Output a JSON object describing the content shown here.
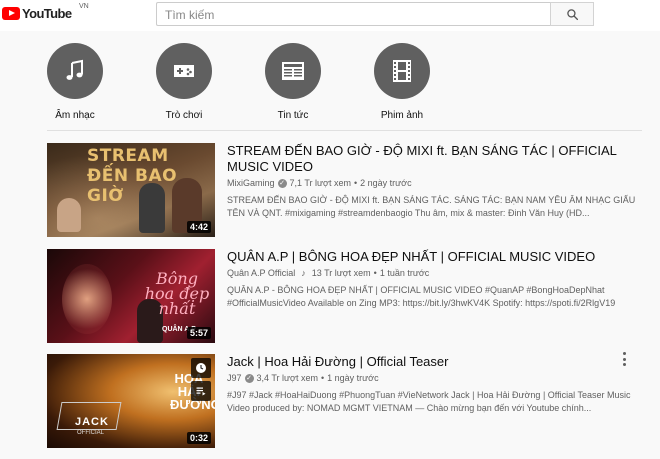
{
  "header": {
    "logo_text": "YouTube",
    "country": "VN",
    "search_placeholder": "Tìm kiếm"
  },
  "categories": [
    {
      "label": "Âm nhạc",
      "icon": "music-note-icon"
    },
    {
      "label": "Trò chơi",
      "icon": "gamepad-icon"
    },
    {
      "label": "Tin tức",
      "icon": "newspaper-icon"
    },
    {
      "label": "Phim ảnh",
      "icon": "film-icon"
    }
  ],
  "videos": [
    {
      "title": "STREAM ĐẾN BAO GIỜ - ĐỘ MIXI ft. BẠN SÁNG TÁC | OFFICIAL MUSIC VIDEO",
      "channel": "MixiGaming",
      "views": "7,1 Tr lượt xem",
      "age": "2 ngày trước",
      "description": "STREAM ĐẾN BAO GIỜ - ĐỘ MIXI ft. BẠN SÁNG TÁC. SÁNG TÁC: BẠN NAM YÊU ÂM NHẠC GIẤU TÊN VÀ QNT. #mixigaming #streamdenbaogio Thu âm, mix & master: Đinh Văn Huy (HD...",
      "duration": "4:42",
      "thumb_text": "STREAM ĐẾN BAO GIỜ"
    },
    {
      "title": "QUÂN A.P | BÔNG HOA ĐẸP NHẤT | OFFICIAL MUSIC VIDEO",
      "channel": "Quân A.P Official",
      "views": "13 Tr lượt xem",
      "age": "1 tuần trước",
      "description": "QUÂN A.P - BÔNG HOA ĐẸP NHẤT | OFFICIAL MUSIC VIDEO #QuanAP #BongHoaDepNhat #OfficialMusicVideo Available on Zing MP3: https://bit.ly/3hwKV4K Spotify: https://spoti.fi/2RlgV19",
      "duration": "5:57",
      "thumb_text": "Bông hoa đẹp nhất",
      "thumb_sub": "QUÂN A.P"
    },
    {
      "title": "Jack | Hoa Hải Đường | Official Teaser",
      "channel": "J97",
      "views": "3,4 Tr lượt xem",
      "age": "1 ngày trước",
      "description": "#J97 #Jack #HoaHaiDuong #PhuongTuan #VieNetwork Jack | Hoa Hải Đường | Official Teaser Music Video produced by: NOMAD MGMT VIETNAM — Chào mừng bạn đến với Youtube chính...",
      "duration": "0:32",
      "thumb_text": "HOA HẢI ĐƯỜNG",
      "thumb_sub": "JACK",
      "thumb_sub2": "OFFICIAL"
    }
  ]
}
